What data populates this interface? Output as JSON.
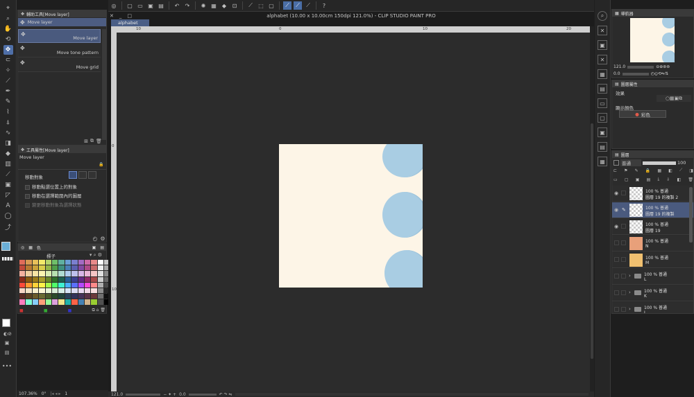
{
  "toolbar": {
    "tools": [
      "pointer-icon",
      "zoom-icon",
      "hand-icon",
      "rotate-icon",
      "move-layer-icon",
      "lasso-icon",
      "magic-wand-icon",
      "eyedropper-icon",
      "pen-icon",
      "pencil-icon",
      "brush-icon",
      "airbrush-icon",
      "blend-icon",
      "eraser-icon",
      "fill-icon",
      "gradient-icon",
      "figure-icon",
      "frame-icon",
      "ruler-icon",
      "text-icon",
      "balloon-icon",
      "line-correct-icon"
    ],
    "active_tool_index": 4
  },
  "sub_tool_panel": {
    "title": "輔助工具[Move layer]",
    "items": [
      "Move layer",
      "Move layer",
      "Move tone pattern",
      "Move grid"
    ],
    "selected_index": 1
  },
  "tool_property": {
    "title": "工具屬性[Move layer]",
    "tool_name": "Move layer",
    "target_label": "移動對象",
    "options": [
      {
        "label": "移動點選位置上的對象",
        "checked": false
      },
      {
        "label": "移動在選擇範圍內的圖層",
        "checked": false
      },
      {
        "label": "變更移動對象為選擇狀態",
        "checked": false,
        "disabled": true
      }
    ]
  },
  "color_panel": {
    "tab_label": "色",
    "set_title": "標子",
    "swatch_colors": [
      "#e06c5a",
      "#d89a52",
      "#e8c15a",
      "#f3ea6a",
      "#b5d66a",
      "#6fbf6a",
      "#5fb0a0",
      "#6a9fd6",
      "#7b7fcf",
      "#a46ac4",
      "#cf6aa8",
      "#e88a8a",
      "#ffffff",
      "#c8c8c8",
      "#c24a3a",
      "#b87a32",
      "#c9a23a",
      "#d9cd4a",
      "#95b64a",
      "#4f9f4a",
      "#3f9080",
      "#4a7fb6",
      "#5b5faf",
      "#844aa4",
      "#af4a88",
      "#c86a6a",
      "#f0f0f0",
      "#a8a8a8",
      "#f4b0a0",
      "#f0cfa0",
      "#f6e4a6",
      "#fbf4b0",
      "#d8ecb0",
      "#b8e0b0",
      "#b0dcd2",
      "#b0cdee",
      "#bdbfeb",
      "#d6b6e6",
      "#eab6d6",
      "#f6c6c6",
      "#e0e0e0",
      "#888888",
      "#8a2a1a",
      "#8a5a12",
      "#9a7a1a",
      "#a99d2a",
      "#6a862a",
      "#2f6f2a",
      "#1f6050",
      "#2a5f96",
      "#3b3f8f",
      "#642a84",
      "#8f2a68",
      "#a84a4a",
      "#d0d0d0",
      "#686868",
      "#ff4a3a",
      "#ff9a32",
      "#ffd23a",
      "#fff14a",
      "#a5f64a",
      "#4fff6a",
      "#3ff0d0",
      "#4aafff",
      "#5b6fff",
      "#b44aff",
      "#ff4ad8",
      "#ff8a8a",
      "#b0b0b0",
      "#484848",
      "#f7d6c6",
      "#f3e3c6",
      "#f8efcc",
      "#fdf8d6",
      "#e8f4d6",
      "#d8ecd6",
      "#d6eee8",
      "#d6e4f6",
      "#dcdcf4",
      "#e8d8f2",
      "#f2d8e8",
      "#f8e0e0",
      "#909090",
      "#282828",
      "#5a2a22",
      "#5a4222",
      "#6a5a2a",
      "#6a6a32",
      "#4a5a2a",
      "#2a4a2a",
      "#22443c",
      "#2a405a",
      "#32325a",
      "#46325a",
      "#5a3248",
      "#6a3a3a",
      "#707070",
      "#101010",
      "#ff7fbf",
      "#7fffd4",
      "#87cefa",
      "#ffa07a",
      "#98fb98",
      "#dda0dd",
      "#f0e68c",
      "#20b2aa",
      "#ff6347",
      "#4682b4",
      "#d2b48c",
      "#9acd32",
      "#505050",
      "#000000"
    ]
  },
  "doc": {
    "title": "alphabet (10.00 x 10.00cm 150dpi 121.0%) - CLIP STUDIO PAINT PRO",
    "tab": "alphabet",
    "ruler_h": [
      "10",
      "0",
      "10",
      "20"
    ],
    "ruler_v": [
      "0",
      "10"
    ],
    "zoom_bottom": "121.0",
    "rotation_bottom": "0.0"
  },
  "status": {
    "zoom": "107.36%",
    "angle": "0°",
    "page": "1"
  },
  "navigator": {
    "title": "導航器",
    "zoom": "121.0",
    "angle": "0.0"
  },
  "layer_property": {
    "title": "圖層屬性",
    "effect_label": "效果",
    "display_color_label": "顯示顏色",
    "display_color_value": "彩色"
  },
  "layers_panel": {
    "title": "圖層",
    "blend_mode": "普通",
    "opacity": "100",
    "layers": [
      {
        "opacity": "100 %",
        "mode": "普通",
        "name": "圖層 19 的複製 2",
        "type": "raster",
        "thumb": "#ffffff",
        "visible": true,
        "selected": false
      },
      {
        "opacity": "100 %",
        "mode": "普通",
        "name": "圖層 19 的複製",
        "type": "raster",
        "thumb": "#ffffff",
        "visible": true,
        "selected": true
      },
      {
        "opacity": "100 %",
        "mode": "普通",
        "name": "圖層 19",
        "type": "raster",
        "thumb": "#ffffff",
        "visible": true,
        "selected": false
      },
      {
        "opacity": "100 %",
        "mode": "普通",
        "name": "N",
        "type": "raster",
        "thumb": "#e8a07a",
        "visible": false,
        "selected": false
      },
      {
        "opacity": "100 %",
        "mode": "普通",
        "name": "M",
        "type": "raster",
        "thumb": "#f0c070",
        "visible": false,
        "selected": false
      },
      {
        "opacity": "100 %",
        "mode": "普通",
        "name": "L",
        "type": "folder",
        "visible": false,
        "selected": false
      },
      {
        "opacity": "100 %",
        "mode": "普通",
        "name": "K",
        "type": "folder",
        "visible": false,
        "selected": false
      },
      {
        "opacity": "100 %",
        "mode": "普通",
        "name": "J",
        "type": "folder",
        "visible": false,
        "selected": false
      },
      {
        "opacity": "100 %",
        "mode": "普通",
        "name": "",
        "type": "folder",
        "visible": false,
        "selected": false
      }
    ]
  },
  "colors": {
    "accent": "#4f6fa8",
    "main_color": "#6aaed6",
    "canvas_paper": "#fdf5e7",
    "blob": "#a9cde3"
  }
}
